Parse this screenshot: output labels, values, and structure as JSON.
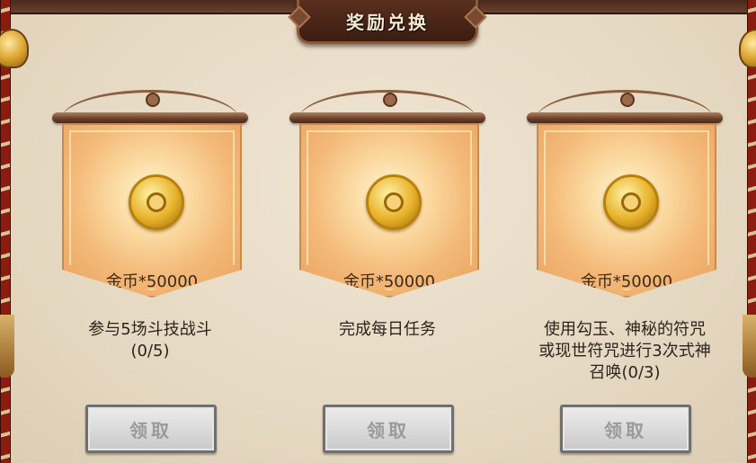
{
  "title": "奖励兑换",
  "cards": [
    {
      "reward": "金币*50000",
      "task_lines": [
        "参与5场斗技战斗",
        "(0/5)"
      ],
      "button": "领取"
    },
    {
      "reward": "金币*50000",
      "task_lines": [
        "完成每日任务"
      ],
      "button": "领取"
    },
    {
      "reward": "金币*50000",
      "task_lines": [
        "使用勾玉、神秘的符咒",
        "或现世符咒进行3次式神",
        "召唤(0/3)"
      ],
      "button": "领取"
    }
  ],
  "colors": {
    "title_plate": "#3b1d12",
    "banner": "#f3b978",
    "button_disabled": "#c9c9c9",
    "text": "#2b241c"
  },
  "icons": [
    "gold-coin-icon",
    "bell-icon"
  ]
}
